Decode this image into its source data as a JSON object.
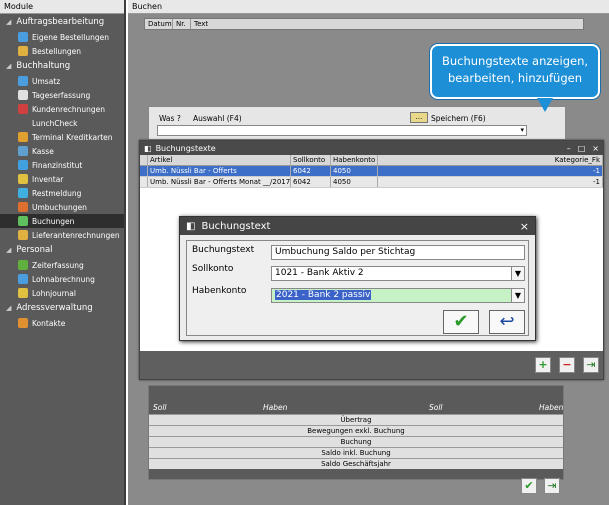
{
  "sidebar": {
    "header": "Module",
    "sections": [
      {
        "label": "Auftragsbearbeitung",
        "items": [
          {
            "label": "Eigene Bestellungen",
            "icon": "cart-icon",
            "color": "#4a9ee0"
          },
          {
            "label": "Bestellungen",
            "icon": "box-icon",
            "color": "#e0b040"
          }
        ]
      },
      {
        "label": "Buchhaltung",
        "items": [
          {
            "label": "Umsatz",
            "icon": "chart-icon",
            "color": "#4a9ee0"
          },
          {
            "label": "Tageserfassung",
            "icon": "calendar-icon",
            "color": "#e0e0e0"
          },
          {
            "label": "Kundenrechnungen",
            "icon": "invoice-icon",
            "color": "#d04040"
          },
          {
            "label": "LunchCheck",
            "icon": "",
            "color": ""
          },
          {
            "label": "Terminal Kreditkarten",
            "icon": "card-icon",
            "color": "#e0a030"
          },
          {
            "label": "Kasse",
            "icon": "cash-icon",
            "color": "#60a0d0"
          },
          {
            "label": "Finanzinstitut",
            "icon": "bank-icon",
            "color": "#40a0e0"
          },
          {
            "label": "Inventar",
            "icon": "inventory-icon",
            "color": "#e0c040"
          },
          {
            "label": "Restmeldung",
            "icon": "report-icon",
            "color": "#40b0e0"
          },
          {
            "label": "Umbuchungen",
            "icon": "transfer-icon",
            "color": "#e07030"
          },
          {
            "label": "Buchungen",
            "icon": "booking-icon",
            "color": "#60c060",
            "active": true
          },
          {
            "label": "Lieferantenrechnungen",
            "icon": "supplier-icon",
            "color": "#e0b040"
          }
        ]
      },
      {
        "label": "Personal",
        "items": [
          {
            "label": "Zeiterfassung",
            "icon": "clock-icon",
            "color": "#60b040"
          },
          {
            "label": "Lohnabrechnung",
            "icon": "payroll-icon",
            "color": "#4a9ee0"
          },
          {
            "label": "Lohnjournal",
            "icon": "journal-icon",
            "color": "#e0c040"
          }
        ]
      },
      {
        "label": "Adressverwaltung",
        "items": [
          {
            "label": "Kontakte",
            "icon": "contacts-icon",
            "color": "#e09030"
          }
        ]
      }
    ]
  },
  "main": {
    "header": "Buchen",
    "grid_cols": [
      "Datum",
      "Nr.",
      "Text"
    ],
    "was_label": "Was ?",
    "auswahl_label": "Auswahl (F4)",
    "speichern_label": "Speichern (F6)",
    "dots_label": "..."
  },
  "bubble": {
    "line1": "Buchungstexte anzeigen,",
    "line2": "bearbeiten, hinzufügen"
  },
  "window": {
    "title": "Buchungstexte",
    "controls": [
      "–",
      "□",
      "×"
    ],
    "columns": [
      "Artikel",
      "Sollkonto",
      "Habenkonto",
      "Kategorie_Fk"
    ],
    "rows": [
      {
        "artikel": "Umb. Nüssli Bar - Offerts",
        "soll": "6042",
        "haben": "4050",
        "kat": "-1"
      },
      {
        "artikel": "Umb. Nüssli Bar - Offerts Monat __/2017",
        "soll": "6042",
        "haben": "4050",
        "kat": "-1"
      }
    ]
  },
  "dialog": {
    "title": "Buchungstext",
    "close": "×",
    "buchungstext_label": "Buchungstext",
    "buchungstext_value": "Umbuchung Saldo per Stichtag",
    "soll_label": "Sollkonto",
    "soll_value": "1021 - Bank Aktiv 2",
    "haben_label": "Habenkonto",
    "haben_value": "2021 - Bank 2 passiv"
  },
  "summary": {
    "headers": [
      "Soll",
      "Haben",
      "Soll",
      "Haben"
    ],
    "rows": [
      "Übertrag",
      "Bewegungen exkl. Buchung",
      "Buchung",
      "Saldo inkl. Buchung",
      "Saldo Geschäftsjahr"
    ]
  }
}
